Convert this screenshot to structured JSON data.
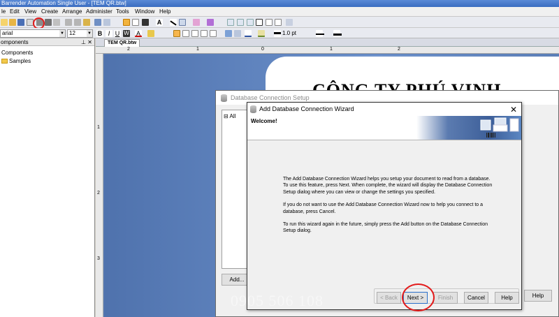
{
  "app": {
    "title": "Barrender Automation Single User - [TEM QR.btw]"
  },
  "menu": [
    "le",
    "Edit",
    "View",
    "Create",
    "Arrange",
    "Administer",
    "Tools",
    "Window",
    "Help"
  ],
  "toolbar2": {
    "font_name": "arial",
    "font_size": "12",
    "line_width": "1.0 pt"
  },
  "left_panel": {
    "header": "omponents",
    "items": [
      {
        "label": "Components"
      },
      {
        "label": "Samples"
      }
    ]
  },
  "document": {
    "tab_label": "TEM QR.btw",
    "ruler_h": [
      "2",
      "1",
      "0",
      "1",
      "2"
    ],
    "ruler_v": [
      "1",
      "2",
      "3"
    ],
    "company_text": "CÔNG TY PHÚ VINH"
  },
  "db_setup_dialog": {
    "title": "Database Connection Setup",
    "tree_item": "All",
    "add_button": "Add...",
    "help_button": "Help"
  },
  "wizard": {
    "title": "Add Database Connection Wizard",
    "close_glyph": "✕",
    "welcome": "Welcome!",
    "paragraphs": [
      "The Add Database Connection Wizard helps you setup your document to read from a database. To use this feature, press Next.  When complete, the wizard will display the Database Connection Setup dialog where you can view or change the settings you specified.",
      "If you do not want to use the Add Database Connection Wizard now to help you connect to a database, press Cancel.",
      "To run this wizard again in the future, simply press the Add button on the Database Connection Setup dialog."
    ],
    "buttons": {
      "back": "< Back",
      "next": "Next >",
      "finish": "Finish",
      "cancel": "Cancel",
      "help": "Help"
    }
  },
  "watermark": "0905 506 108",
  "colors": {
    "highlight_circle": "#e31b1b",
    "canvas_blue": "#5b7eb7",
    "titlebar": "#3a6cc0"
  }
}
